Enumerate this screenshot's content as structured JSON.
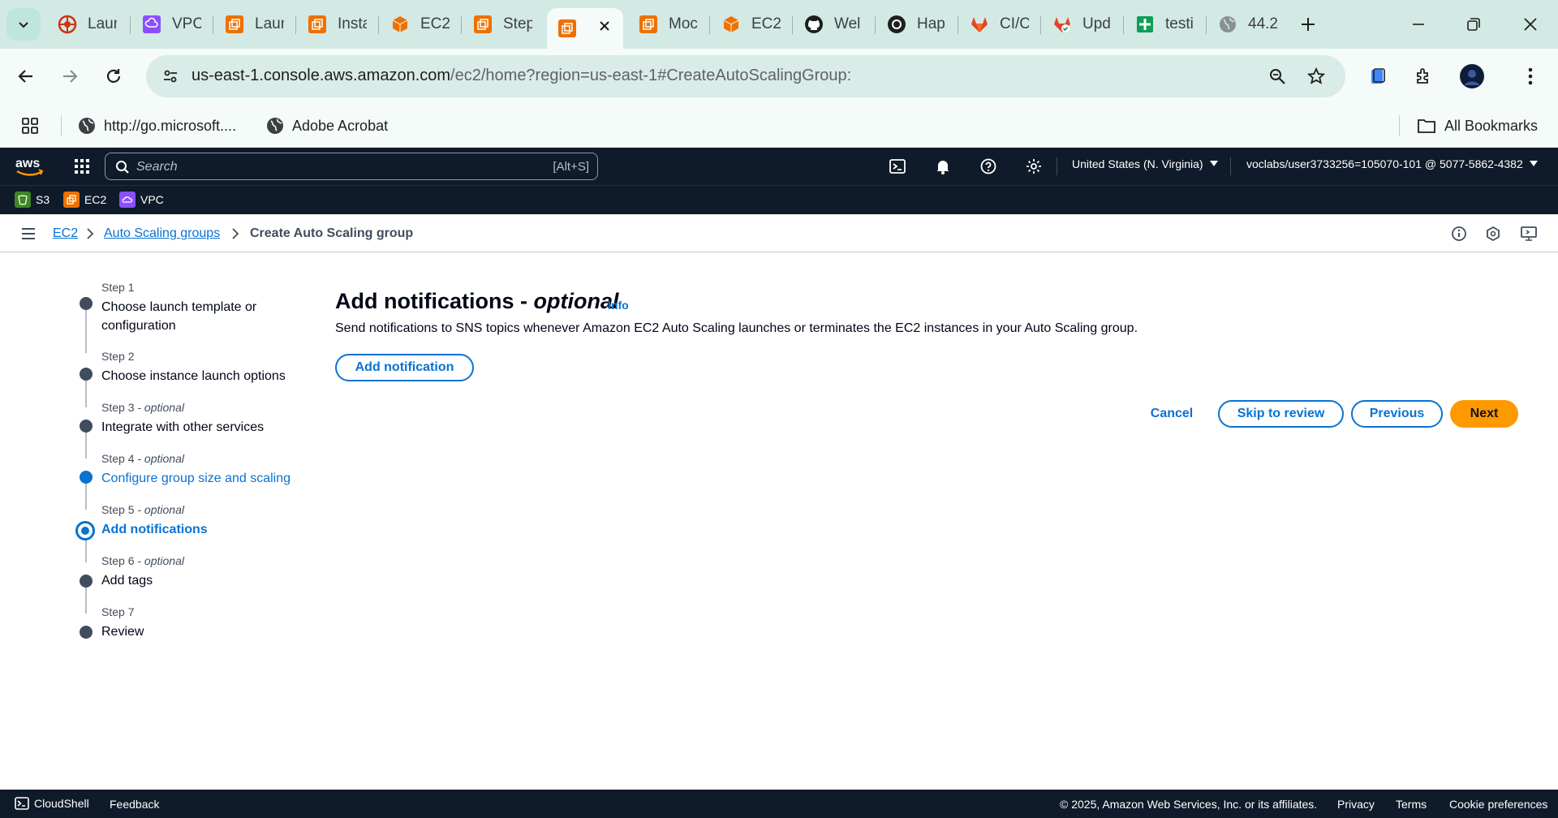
{
  "browser": {
    "tabs": [
      {
        "title": "Laun",
        "icon": "aws-red-icon"
      },
      {
        "title": "VPC",
        "icon": "vpc-icon"
      },
      {
        "title": "Laun",
        "icon": "ec2-icon"
      },
      {
        "title": "Insta",
        "icon": "ec2-icon"
      },
      {
        "title": "EC2",
        "icon": "ec2-cube-icon"
      },
      {
        "title": "Step",
        "icon": "ec2-icon"
      },
      {
        "title": "",
        "icon": "ec2-icon",
        "active": true
      },
      {
        "title": "Moc",
        "icon": "ec2-icon"
      },
      {
        "title": "EC2",
        "icon": "ec2-cube-icon"
      },
      {
        "title": "Wel",
        "icon": "github-icon"
      },
      {
        "title": "Hap",
        "icon": "openai-icon"
      },
      {
        "title": "CI/C",
        "icon": "gitlab-icon"
      },
      {
        "title": "Upd",
        "icon": "gitlab-icon"
      },
      {
        "title": "testi",
        "icon": "sheets-icon"
      },
      {
        "title": "44.2",
        "icon": "globe-icon"
      }
    ],
    "url_host": "us-east-1.console.aws.amazon.com",
    "url_rest": "/ec2/home?region=us-east-1#CreateAutoScalingGroup:",
    "bookmarks": [
      {
        "label": "http://go.microsoft....",
        "icon": "globe-icon"
      },
      {
        "label": "Adobe Acrobat",
        "icon": "globe-icon"
      }
    ],
    "all_bookmarks": "All Bookmarks"
  },
  "aws_header": {
    "search_placeholder": "Search",
    "search_shortcut": "[Alt+S]",
    "region": "United States (N. Virginia)",
    "account": "voclabs/user3733256=105070-101 @ 5077-5862-4382",
    "favorites": [
      "S3",
      "EC2",
      "VPC"
    ]
  },
  "breadcrumb": {
    "items": [
      "EC2",
      "Auto Scaling groups",
      "Create Auto Scaling group"
    ]
  },
  "steps": [
    {
      "num": "Step 1",
      "optional": "",
      "title": "Choose launch template or configuration",
      "state": "default"
    },
    {
      "num": "Step 2",
      "optional": "",
      "title": "Choose instance launch options",
      "state": "default"
    },
    {
      "num": "Step 3",
      "optional": " - optional",
      "title": "Integrate with other services",
      "state": "default"
    },
    {
      "num": "Step 4",
      "optional": " - optional",
      "title": "Configure group size and scaling",
      "state": "done"
    },
    {
      "num": "Step 5",
      "optional": " - optional",
      "title": "Add notifications",
      "state": "current"
    },
    {
      "num": "Step 6",
      "optional": " - optional",
      "title": "Add tags",
      "state": "default"
    },
    {
      "num": "Step 7",
      "optional": "",
      "title": "Review",
      "state": "default"
    }
  ],
  "main": {
    "title": "Add notifications - ",
    "title_optional": "optional",
    "info": "Info",
    "description": "Send notifications to SNS topics whenever Amazon EC2 Auto Scaling launches or terminates the EC2 instances in your Auto Scaling group.",
    "add_notification": "Add notification",
    "cancel": "Cancel",
    "skip_to_review": "Skip to review",
    "previous": "Previous",
    "next": "Next"
  },
  "footer": {
    "cloudshell": "CloudShell",
    "feedback": "Feedback",
    "copyright": "© 2025, Amazon Web Services, Inc. or its affiliates.",
    "privacy": "Privacy",
    "terms": "Terms",
    "cookie": "Cookie preferences"
  },
  "colors": {
    "aws_nav": "#0f1b2a",
    "link_blue": "#0972d3",
    "primary_orange": "#ff9900",
    "tab_strip": "#d3e9e4"
  }
}
